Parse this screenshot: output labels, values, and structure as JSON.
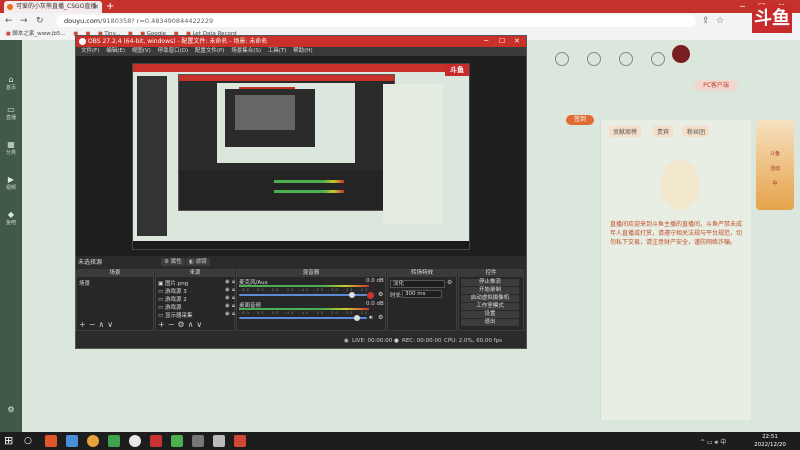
{
  "browser": {
    "tab_title": "可爱的小灰熊直播_CSGO直播",
    "url_host": "douyu.com",
    "url_rest": "/9180358? r=0.483490844422229",
    "bookmarks": [
      "脚本之家_www.jb5...",
      "",
      "",
      "Tiny...",
      "",
      "Google",
      "",
      "Let Data Record"
    ]
  },
  "site": {
    "logo_text": "斗鱼",
    "left_rail": [
      "首页",
      "直播",
      "分类",
      "视频",
      "鱼吧",
      "游戏",
      "应用"
    ],
    "top_icons": [
      "",
      "",
      "",
      "",
      "",
      ""
    ],
    "pc_button": "PC客户端",
    "sign_button": "签到",
    "right_tabs": [
      "贡献周榜",
      "贵宾",
      "粉丝团"
    ],
    "chat_message": "直播间欢迎来到斗鱼主播的直播间，斗鱼严禁未成年人直播或打赏，请遵守相关法规与平台规范，切勿私下交易，请注意财产安全，谨防网络诈骗。",
    "promo_lines": [
      "斗鱼",
      "活动",
      "中"
    ]
  },
  "obs": {
    "title": "OBS 27.2.4 (64-bit, windows) - 配置文件: 未命名 - 场景: 未命名",
    "menu": [
      "文件(F)",
      "编辑(E)",
      "视图(V)",
      "停靠窗口(D)",
      "配置文件(P)",
      "场景集合(S)",
      "工具(T)",
      "帮助(H)"
    ],
    "scene_bar_label": "未选择源",
    "scene_bar_buttons": [
      "属性",
      "滤镜"
    ],
    "docks": {
      "scenes": {
        "title": "场景",
        "items": [
          "场景"
        ]
      },
      "sources": {
        "title": "来源",
        "items": [
          {
            "icon": "image-icon",
            "name": "图片.png"
          },
          {
            "icon": "monitor-icon",
            "name": "游戏源 3"
          },
          {
            "icon": "monitor-icon",
            "name": "游戏源 2"
          },
          {
            "icon": "monitor-icon",
            "name": "游戏源"
          },
          {
            "icon": "monitor-icon",
            "name": "显示器采集"
          }
        ]
      },
      "mixer": {
        "title": "混音器",
        "channels": [
          {
            "name": "麦克风/Aux",
            "db": "0.0 dB",
            "level": 0.88,
            "muted": true
          },
          {
            "name": "桌面音频",
            "db": "0.0 dB",
            "level": 0.92,
            "muted": false
          }
        ],
        "scale": "-60 -55 -50 -45 -40 -35 -30 -25 -20 -15 -10 -5 0"
      },
      "transitions": {
        "title": "转场特效",
        "selected": "淡化",
        "duration_label": "时长",
        "duration_value": "300 ms"
      },
      "controls": {
        "title": "控件",
        "buttons": [
          "停止推流",
          "开始录制",
          "启动虚拟摄像机",
          "工作室模式",
          "设置",
          "退出"
        ]
      }
    },
    "status": {
      "live": "LIVE: 00:00:00",
      "rec": "REC: 00:00:00",
      "cpu": "CPU: 2.0%, 60.00 fps"
    }
  },
  "taskbar": {
    "time": "22:51",
    "date": "2022/12/20",
    "colors": [
      "#e2572c",
      "#4a90d9",
      "#e6a23c",
      "#3fa34d",
      "#e8e8e8",
      "#c83232",
      "#4caf50",
      "#777777",
      "#bbbbbb",
      "#d14836"
    ]
  }
}
